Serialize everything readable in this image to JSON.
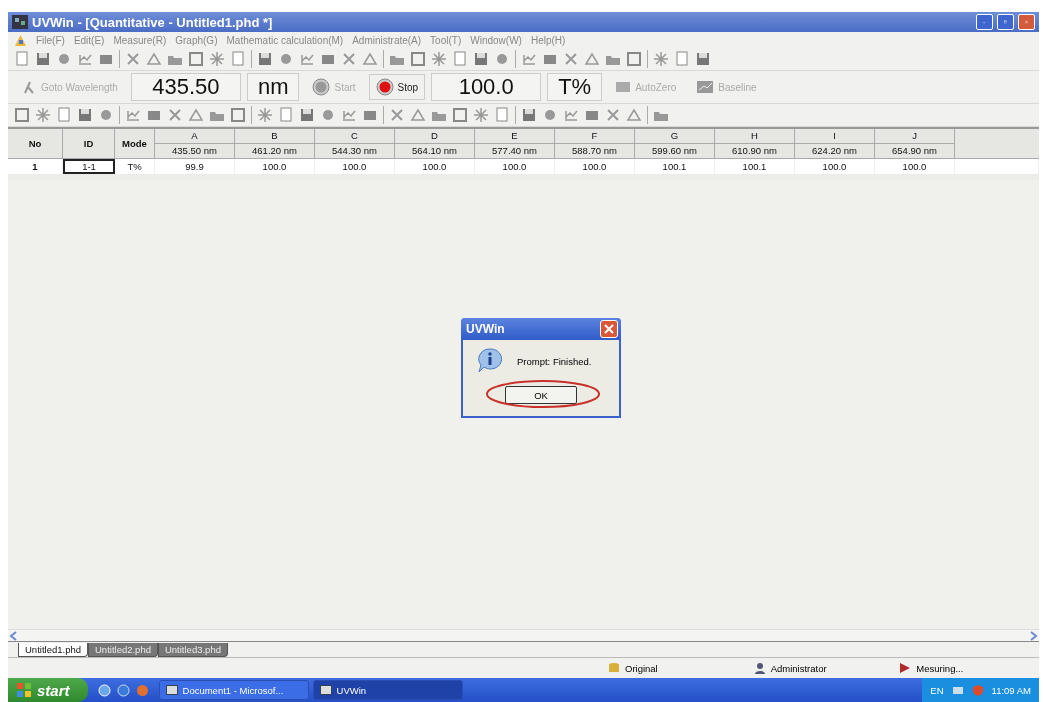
{
  "window": {
    "title": "UVWin - [Quantitative - Untitled1.phd *]"
  },
  "menu": [
    "File(F)",
    "Edit(E)",
    "Measure(R)",
    "Graph(G)",
    "Mathematic calculation(M)",
    "Administrate(A)",
    "Tool(T)",
    "Window(W)",
    "Help(H)"
  ],
  "measure_bar": {
    "goto_button": {
      "label": "Goto Wavelength",
      "disabled": true
    },
    "wavelength": "435.50",
    "wavelength_unit": "nm",
    "start_button": {
      "label": "Start",
      "disabled": true
    },
    "stop_button": {
      "label": "Stop",
      "disabled": false
    },
    "reading": "100.0",
    "reading_unit": "T%",
    "autozero_button": {
      "label": "AutoZero",
      "disabled": true
    },
    "baseline_button": {
      "label": "Baseline",
      "disabled": true
    }
  },
  "table": {
    "columns": [
      {
        "name": "No"
      },
      {
        "name": "ID"
      },
      {
        "name": "Mode"
      },
      {
        "name": "A",
        "wavelength": "435.50 nm"
      },
      {
        "name": "B",
        "wavelength": "461.20 nm"
      },
      {
        "name": "C",
        "wavelength": "544.30 nm"
      },
      {
        "name": "D",
        "wavelength": "564.10 nm"
      },
      {
        "name": "E",
        "wavelength": "577.40 nm"
      },
      {
        "name": "F",
        "wavelength": "588.70 nm"
      },
      {
        "name": "G",
        "wavelength": "599.60 nm"
      },
      {
        "name": "H",
        "wavelength": "610.90 nm"
      },
      {
        "name": "I",
        "wavelength": "624.20 nm"
      },
      {
        "name": "J",
        "wavelength": "654.90 nm"
      }
    ],
    "rows": [
      {
        "cells": [
          "1",
          "1-1",
          "T%",
          "99.9",
          "100.0",
          "100.0",
          "100.0",
          "100.0",
          "100.0",
          "100.1",
          "100.1",
          "100.0",
          "100.0"
        ]
      }
    ]
  },
  "dialog": {
    "title": "UVWin",
    "message": "Prompt: Finished.",
    "button": "OK"
  },
  "document_tabs": [
    {
      "label": "Untitled1.phd",
      "selected": true
    },
    {
      "label": "Untitled2.phd",
      "selected": false
    },
    {
      "label": "Untitled3.phd",
      "selected": false
    }
  ],
  "status_bar": [
    {
      "kind": "database",
      "text": "Original"
    },
    {
      "kind": "user",
      "text": "Administrator"
    },
    {
      "kind": "play",
      "text": "Mesuring..."
    }
  ],
  "taskbar": {
    "start": "start",
    "tasks": [
      {
        "label": "Document1 - Microsof...",
        "selected": false
      },
      {
        "label": "UVWin",
        "selected": true
      }
    ],
    "language": "EN",
    "time": "11:09 AM"
  }
}
